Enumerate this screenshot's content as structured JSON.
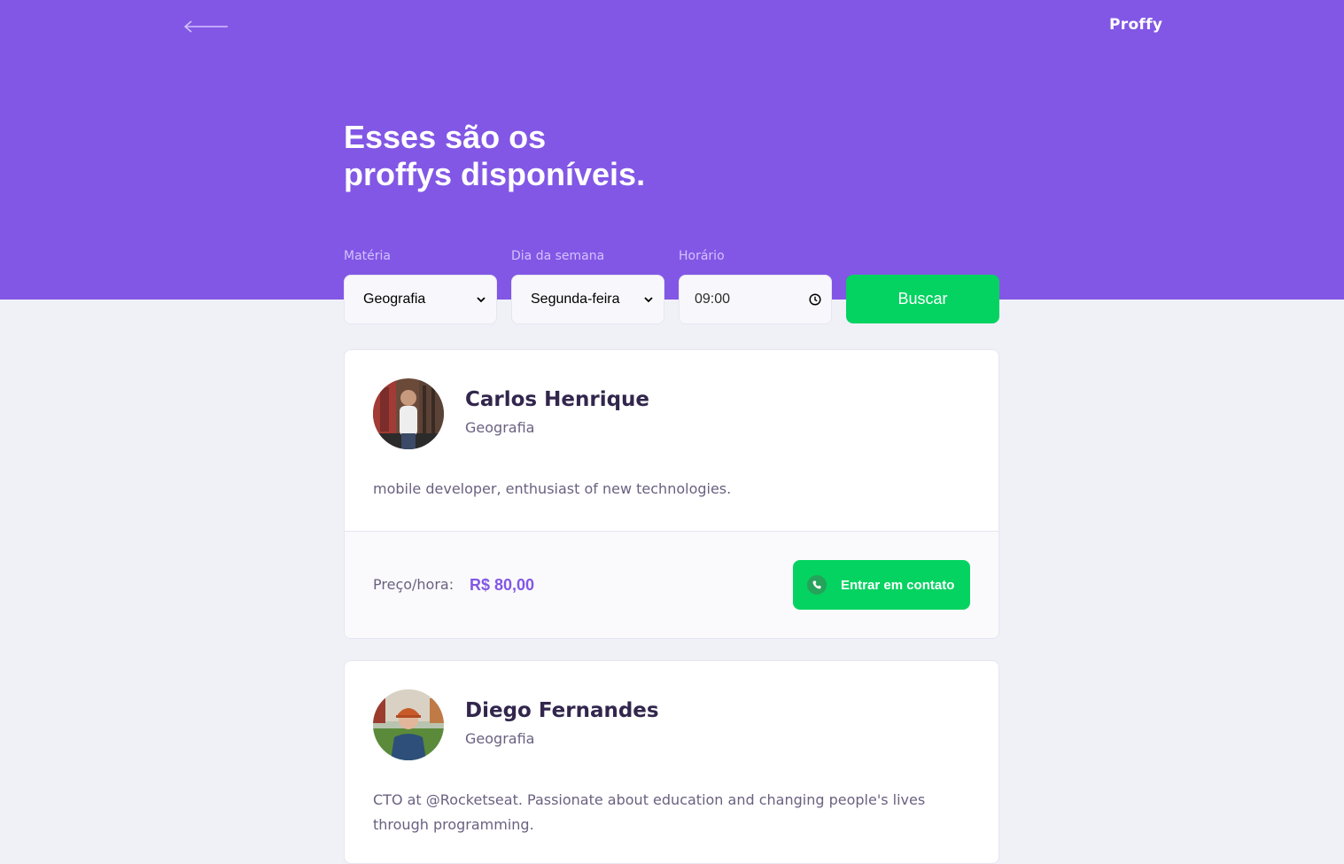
{
  "header": {
    "logo": "Proffy",
    "title_line1": "Esses são os",
    "title_line2": "proffys disponíveis."
  },
  "filters": {
    "subject_label": "Matéria",
    "subject_value": "Geografia",
    "weekday_label": "Dia da semana",
    "weekday_value": "Segunda-feira",
    "time_label": "Horário",
    "time_value": "09:00",
    "search_label": "Buscar"
  },
  "teachers": [
    {
      "name": "Carlos Henrique",
      "subject": "Geografia",
      "bio": "mobile developer, enthusiast of new technologies.",
      "price_label": "Preço/hora:",
      "price": "R$ 80,00",
      "contact_label": "Entrar em contato"
    },
    {
      "name": "Diego Fernandes",
      "subject": "Geografia",
      "bio_line1": "CTO at @Rocketseat. Passionate about education and changing people's lives",
      "bio_line2": "through programming."
    }
  ],
  "colors": {
    "primary": "#8257E5",
    "secondary": "#04D361",
    "background": "#F0F0F7"
  }
}
